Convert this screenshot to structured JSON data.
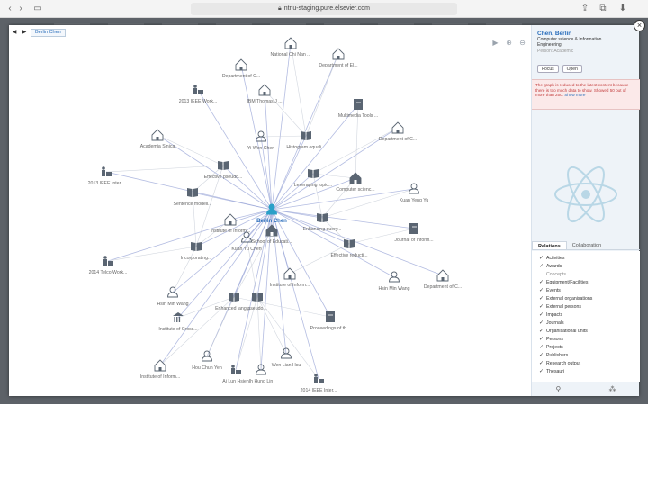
{
  "browser": {
    "url": "ntnu-staging.pure.elsevier.com"
  },
  "breadcrumb": {
    "current": "Berlin Chen"
  },
  "graph": {
    "nodes": [
      {
        "label": "Berlin Chen",
        "kind": "person-center",
        "icon": "person-icon"
      },
      {
        "label": "Department of C...",
        "kind": "org",
        "icon": "building-icon"
      },
      {
        "label": "National Chi Nan ...",
        "kind": "org",
        "icon": "building-icon"
      },
      {
        "label": "Department of El...",
        "kind": "org",
        "icon": "building-icon"
      },
      {
        "label": "2013 IEEE Work...",
        "kind": "event",
        "icon": "podium-icon"
      },
      {
        "label": "IBM Thomas J ...",
        "kind": "org",
        "icon": "building-icon"
      },
      {
        "label": "Multimedia Tools ...",
        "kind": "journal",
        "icon": "journal-icon"
      },
      {
        "label": "Academia Sinica",
        "kind": "org",
        "icon": "building-icon"
      },
      {
        "label": "Yi Wen Chen",
        "kind": "person",
        "icon": "person-icon"
      },
      {
        "label": "Histogram equali...",
        "kind": "output",
        "icon": "book-icon"
      },
      {
        "label": "Department of C...",
        "kind": "org",
        "icon": "building-icon"
      },
      {
        "label": "2013 IEEE Inter...",
        "kind": "event",
        "icon": "podium-icon"
      },
      {
        "label": "Effective pseudo...",
        "kind": "output",
        "icon": "book-icon"
      },
      {
        "label": "Leveraging topic...",
        "kind": "output",
        "icon": "book-icon"
      },
      {
        "label": "Computer scienc...",
        "kind": "org-dark",
        "icon": "building-icon"
      },
      {
        "label": "Sentence modeli...",
        "kind": "output",
        "icon": "book-icon"
      },
      {
        "label": "Kuan Yeng Yu",
        "kind": "person",
        "icon": "person-icon"
      },
      {
        "label": "Institute of Inform...",
        "kind": "org",
        "icon": "building-icon"
      },
      {
        "label": "Enhancing query...",
        "kind": "output",
        "icon": "book-icon"
      },
      {
        "label": "Journal of Inform...",
        "kind": "journal",
        "icon": "journal-icon"
      },
      {
        "label": "School of Educati...",
        "kind": "org-dark",
        "icon": "building-icon"
      },
      {
        "label": "Kuan Yu Chen",
        "kind": "person",
        "icon": "person-icon"
      },
      {
        "label": "Effective reducti...",
        "kind": "output",
        "icon": "book-icon"
      },
      {
        "label": "Incorporating...",
        "kind": "output",
        "icon": "book-icon"
      },
      {
        "label": "2014 Telco Work...",
        "kind": "event",
        "icon": "podium-icon"
      },
      {
        "label": "Institute of Inform...",
        "kind": "org",
        "icon": "building-icon"
      },
      {
        "label": "Hsin Min Wang",
        "kind": "person",
        "icon": "person-icon"
      },
      {
        "label": "Department of C...",
        "kind": "org",
        "icon": "building-icon"
      },
      {
        "label": "Hsin Min Wang",
        "kind": "person",
        "icon": "person-icon"
      },
      {
        "label": "Enhanced langu...",
        "kind": "output",
        "icon": "book-icon"
      },
      {
        "label": "pseudo...",
        "kind": "output",
        "icon": "book-icon"
      },
      {
        "label": "Institute of Cross...",
        "kind": "org",
        "icon": "pillar-icon"
      },
      {
        "label": "Proceedings of th...",
        "kind": "journal",
        "icon": "journal-icon"
      },
      {
        "label": "Hou Chun Yen",
        "kind": "person",
        "icon": "person-icon"
      },
      {
        "label": "Wen Lian Hsu",
        "kind": "person",
        "icon": "person-icon"
      },
      {
        "label": "Institute of Inform...",
        "kind": "org",
        "icon": "building-icon"
      },
      {
        "label": "Ai Lun Hsieh",
        "kind": "event",
        "icon": "podium-icon"
      },
      {
        "label": "Ih Hung Lin",
        "kind": "person",
        "icon": "person-icon"
      },
      {
        "label": "2014 IEEE Inter...",
        "kind": "event",
        "icon": "podium-icon"
      }
    ]
  },
  "panel": {
    "name": "Chen, Berlin",
    "affiliation_line1": "Computer science & Information",
    "affiliation_line2": "Engineering",
    "type": "Person: Academic",
    "focus_label": "Focus",
    "open_label": "Open",
    "notice": "The graph is reduced to the latest content because there is too much data to show. Showed 50 out of more than 250.",
    "notice_link": "Show more",
    "tabs": [
      "Relations",
      "Collaboration"
    ],
    "filters": [
      {
        "label": "Activities",
        "checked": true
      },
      {
        "label": "Awards",
        "checked": true
      },
      {
        "label": "Concepts",
        "checked": false
      },
      {
        "label": "Equipment/Facilities",
        "checked": true
      },
      {
        "label": "Events",
        "checked": true
      },
      {
        "label": "External organisations",
        "checked": true
      },
      {
        "label": "External persons",
        "checked": true
      },
      {
        "label": "Impacts",
        "checked": true
      },
      {
        "label": "Journals",
        "checked": true
      },
      {
        "label": "Organisational units",
        "checked": true
      },
      {
        "label": "Persons",
        "checked": true
      },
      {
        "label": "Projects",
        "checked": true
      },
      {
        "label": "Publishers",
        "checked": true
      },
      {
        "label": "Research output",
        "checked": true
      },
      {
        "label": "Thesauri",
        "checked": true
      }
    ]
  },
  "colors": {
    "accent": "#2a6ebb",
    "icon": "#5a6572",
    "edge": "#9aa6d8",
    "notice": "#c23a3a"
  }
}
